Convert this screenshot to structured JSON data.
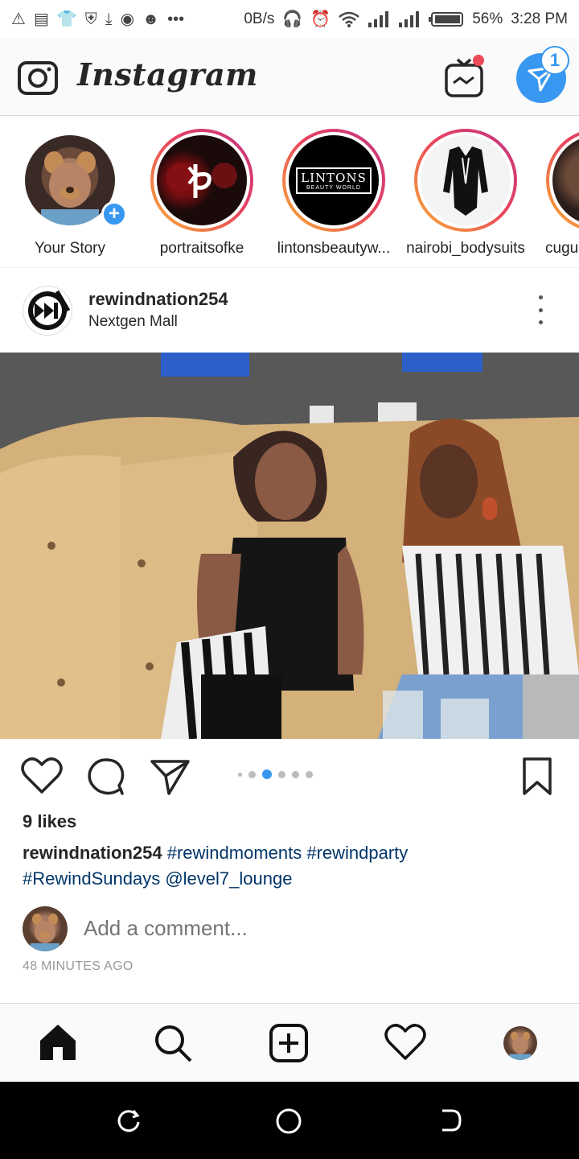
{
  "status_bar": {
    "net_speed": "0B/s",
    "battery": "56%",
    "time": "3:28 PM",
    "left_icons": [
      "alert-icon",
      "notes-icon",
      "shirt-icon",
      "shield-icon",
      "download-icon",
      "chrome-icon",
      "face-icon",
      "more-dots-icon"
    ],
    "right_icons": [
      "headphones-icon",
      "alarm-icon",
      "wifi-icon",
      "signal-icon",
      "signal-icon",
      "battery-icon"
    ]
  },
  "app_bar": {
    "brand": "Instagram",
    "dm_badge": "1"
  },
  "stories": [
    {
      "label": "Your Story",
      "is_own": true
    },
    {
      "label": "portraitsofke",
      "is_own": false
    },
    {
      "label": "lintonsbeautyw...",
      "is_own": false,
      "logo_text": "LINTONS",
      "logo_sub": "BEAUTY WORLD"
    },
    {
      "label": "nairobi_bodysuits",
      "is_own": false
    },
    {
      "label": "cugu",
      "is_own": false
    }
  ],
  "post": {
    "username": "rewindnation254",
    "location": "Nextgen Mall",
    "likes": "9 likes",
    "caption_user": "rewindnation254",
    "caption_tags_line1": "#rewindmoments #rewindparty",
    "caption_tags_line2": "#RewindSundays @level7_lounge",
    "carousel_total": 6,
    "carousel_active": 3,
    "comment_placeholder": "Add a comment...",
    "timestamp": "48 MINUTES AGO"
  },
  "colors": {
    "accent": "#3897f0",
    "hashtag": "#003569",
    "notification": "#ed4956"
  },
  "bottom_nav": [
    "home-icon",
    "search-icon",
    "add-post-icon",
    "activity-heart-icon",
    "profile-avatar"
  ],
  "system_nav": [
    "recents-icon",
    "home-circle-icon",
    "back-icon"
  ]
}
